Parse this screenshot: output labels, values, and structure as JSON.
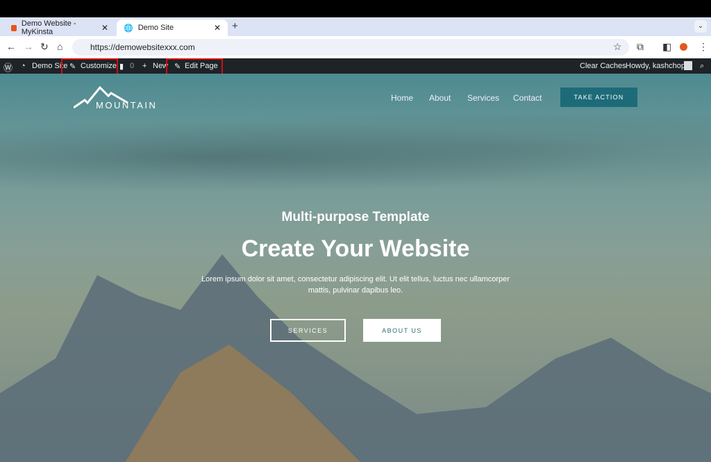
{
  "browser": {
    "tabs": [
      {
        "title": "Demo Website - MyKinsta",
        "icon": "kinsta-icon"
      },
      {
        "title": "Demo Site",
        "icon": "globe-icon",
        "active": true
      }
    ],
    "url": "https://demowebsitexxx.com"
  },
  "adminbar": {
    "site": "Demo Site",
    "customize": "Customize",
    "comments": "0",
    "new": "New",
    "edit": "Edit Page",
    "clear": "Clear Caches",
    "howdy": "Howdy, kashchopra"
  },
  "site": {
    "logo": "MOUNTAIN",
    "menu": [
      "Home",
      "About",
      "Services",
      "Contact"
    ],
    "cta": "TAKE ACTION",
    "subtitle": "Multi-purpose Template",
    "title": "Create Your Website",
    "text": "Lorem ipsum dolor sit amet, consectetur adipiscing elit. Ut elit tellus, luctus nec ullamcorper mattis, pulvinar dapibus leo.",
    "btn1": "SERVICES",
    "btn2": "ABOUT US"
  },
  "colors": {
    "highlight": "#d60c0c",
    "accent": "#1d6b78"
  }
}
